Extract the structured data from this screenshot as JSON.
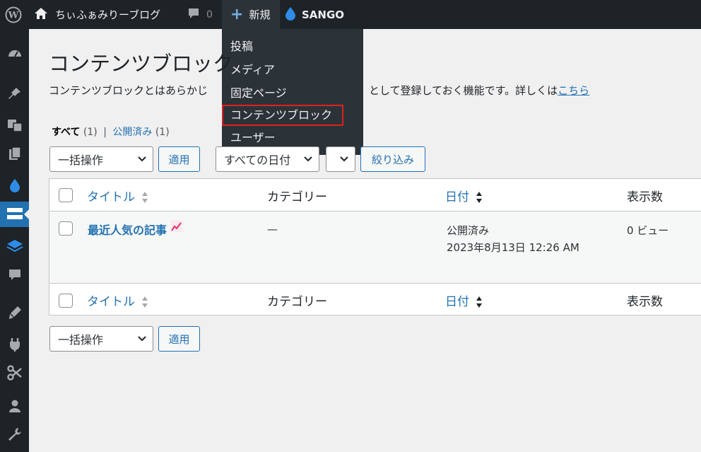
{
  "adminbar": {
    "site_name": "ちぃふぁみりーブログ",
    "comment_count": "0",
    "new_label": "新規",
    "sango_label": "SANGO",
    "new_menu": [
      {
        "label": "投稿"
      },
      {
        "label": "メディア"
      },
      {
        "label": "固定ページ"
      },
      {
        "label": "コンテンツブロック",
        "highlighted": true
      },
      {
        "label": "ユーザー"
      }
    ]
  },
  "sidebar": {
    "icons": [
      "dashboard-icon",
      "pin-icon",
      "media-icon",
      "pages-icon",
      "sango-drop-icon",
      "content-block-icon",
      "layers-icon",
      "comments-icon",
      "appearance-icon",
      "plugins-icon",
      "tools-scissors-icon",
      "users-icon",
      "settings-wrench-icon"
    ],
    "current": "content-block-icon"
  },
  "page": {
    "title": "コンテンツブロック",
    "desc_part1": "コンテンツブロックとはあらかじ",
    "desc_part2": "として登録しておく機能です。詳しくは",
    "desc_link": "こちら"
  },
  "filters": {
    "all_label": "すべて",
    "all_count": "(1)",
    "sep": "|",
    "published_label": "公開済み",
    "published_count": "(1)",
    "bulk_action": "一括操作",
    "apply": "適用",
    "all_dates": "すべての日付",
    "filter_btn": "絞り込み"
  },
  "table": {
    "columns": {
      "title": "タイトル",
      "category": "カテゴリー",
      "date": "日付",
      "views": "表示数"
    },
    "rows": [
      {
        "title": "最近人気の記事",
        "category": "—",
        "status": "公開済み",
        "date": "2023年8月13日 12:26 AM",
        "views": "0 ビュー"
      }
    ]
  },
  "colors": {
    "accent": "#2271b1",
    "adminbar": "#1d2327",
    "highlight_border": "#e0201f"
  }
}
